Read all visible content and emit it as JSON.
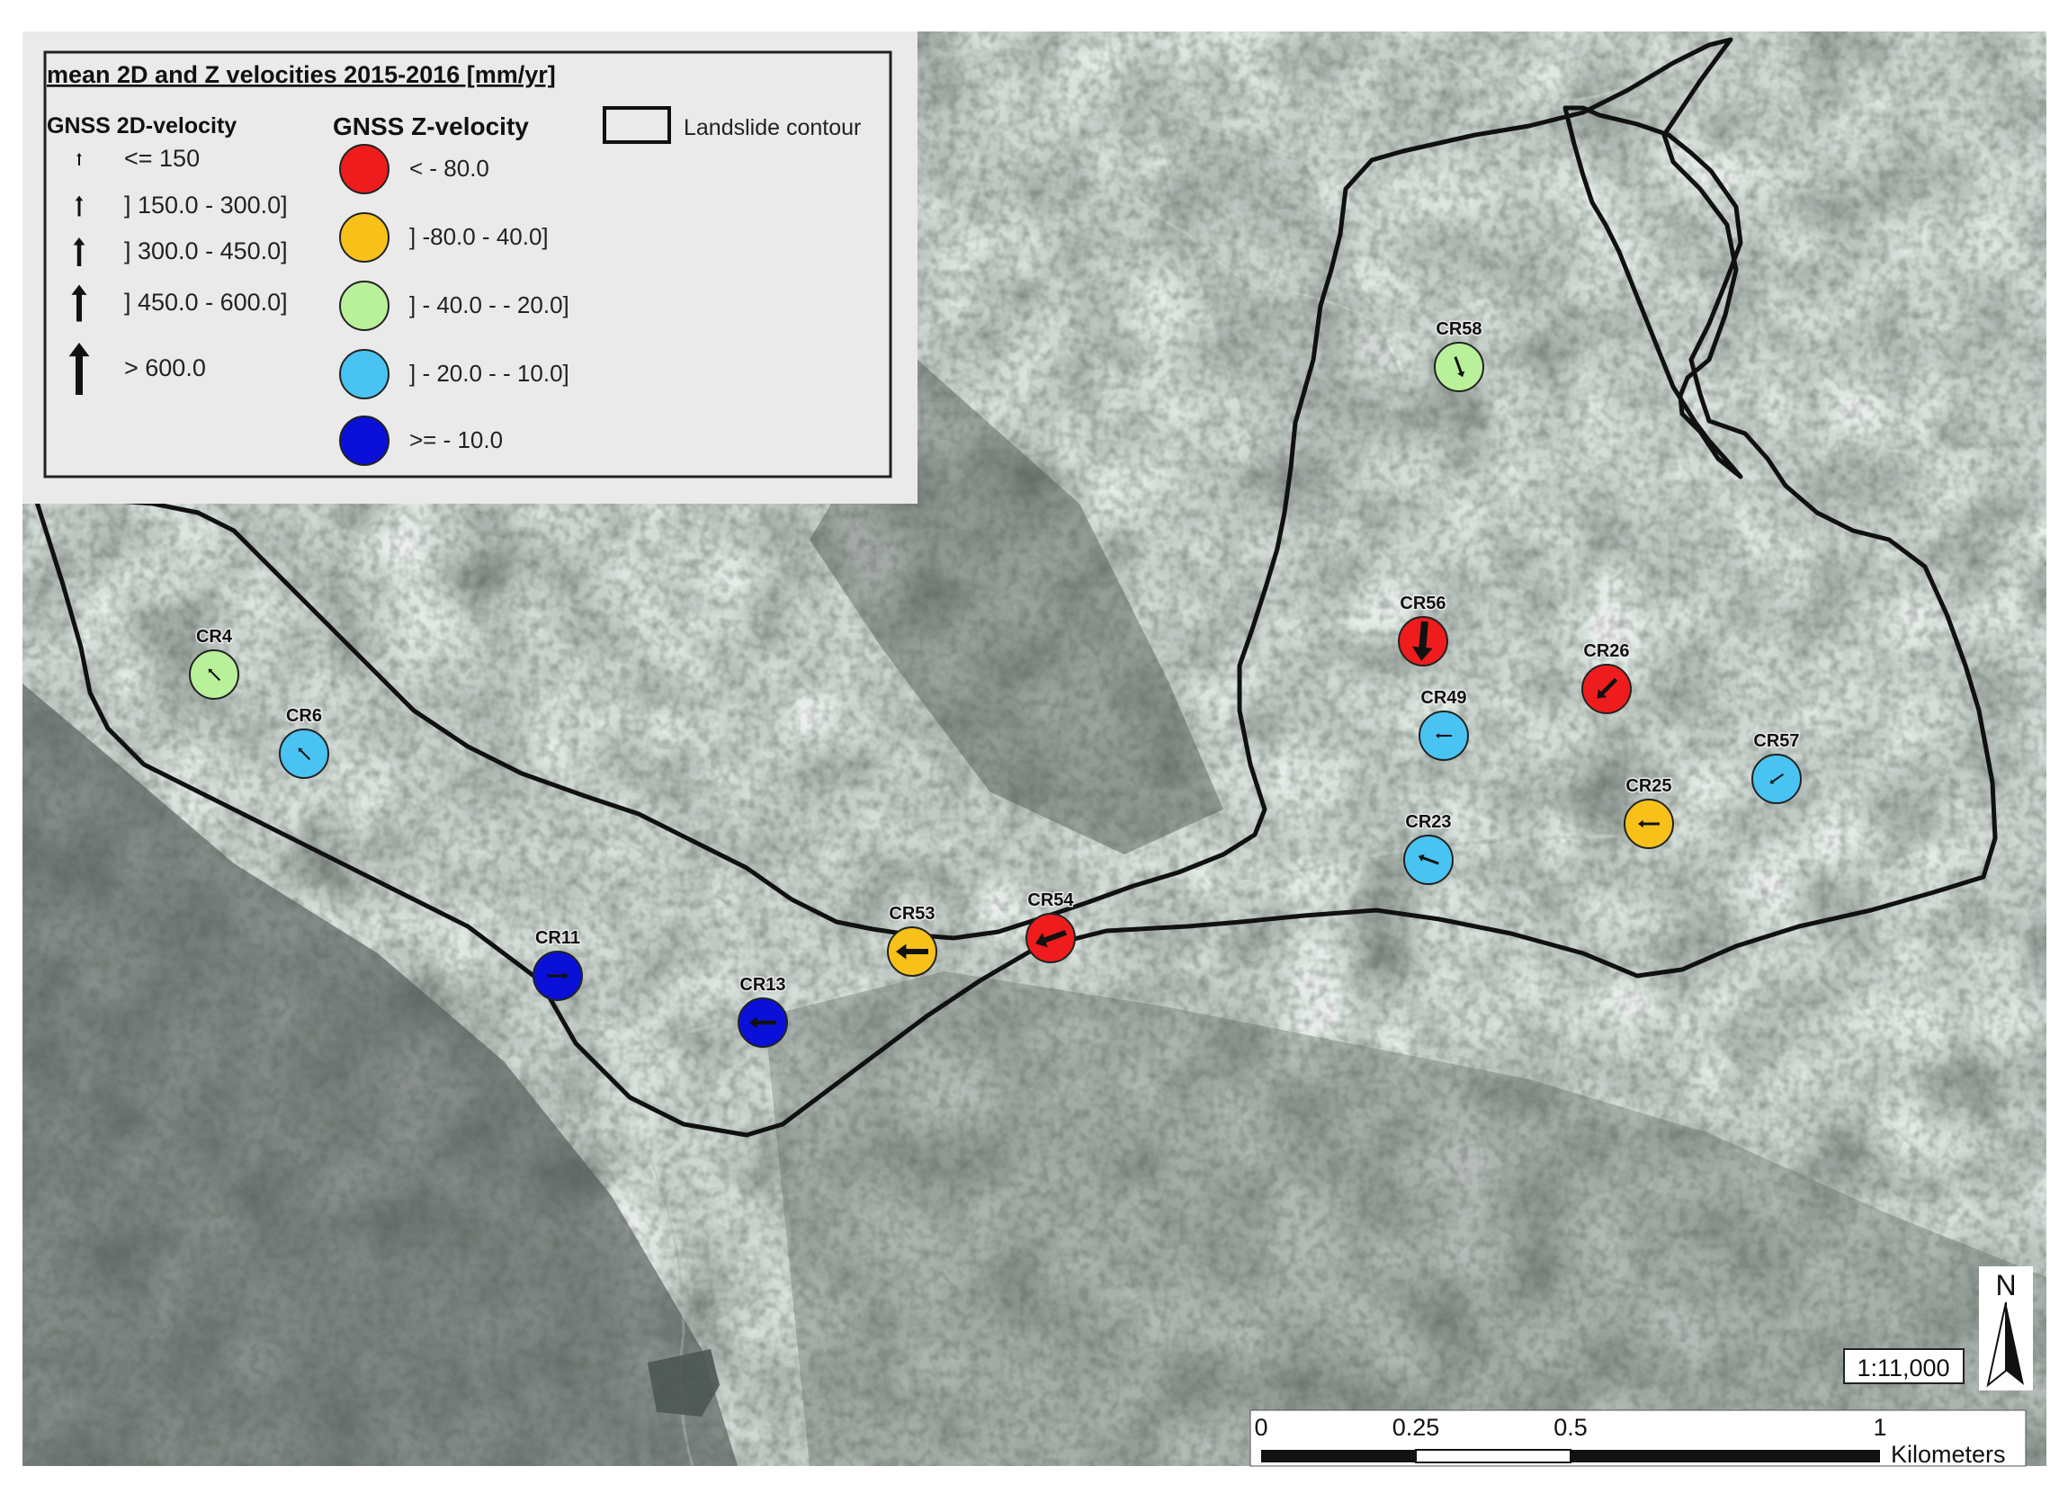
{
  "legend": {
    "title": "mean 2D and Z velocities 2015-2016 [mm/yr]",
    "velocity_2d_title": "GNSS 2D-velocity",
    "velocity_2d_classes": [
      "<= 150",
      "] 150.0 - 300.0]",
      "] 300.0 - 450.0]",
      "] 450.0 - 600.0]",
      "> 600.0"
    ],
    "velocity_z_title": "GNSS Z-velocity",
    "velocity_z_classes": [
      {
        "label": "< - 80.0",
        "color": "#ee1c1c"
      },
      {
        "label": "] -80.0 - 40.0]",
        "color": "#f7c11a"
      },
      {
        "label": "] - 40.0 - - 20.0]",
        "color": "#b8f19a"
      },
      {
        "label": "] - 20.0 - - 10.0]",
        "color": "#49c3f1"
      },
      {
        "label": ">= - 10.0",
        "color": "#0a10d8"
      }
    ],
    "contour_label": "Landslide contour"
  },
  "stations": [
    {
      "name": "CR4",
      "z_class": 2,
      "v_class": 0,
      "dir_deg": 315
    },
    {
      "name": "CR6",
      "z_class": 3,
      "v_class": 0,
      "dir_deg": 315
    },
    {
      "name": "CR11",
      "z_class": 4,
      "v_class": 1,
      "dir_deg": 90
    },
    {
      "name": "CR13",
      "z_class": 4,
      "v_class": 2,
      "dir_deg": 270
    },
    {
      "name": "CR53",
      "z_class": 1,
      "v_class": 3,
      "dir_deg": 270
    },
    {
      "name": "CR54",
      "z_class": 0,
      "v_class": 3,
      "dir_deg": 250
    },
    {
      "name": "CR58",
      "z_class": 2,
      "v_class": 1,
      "dir_deg": 160
    },
    {
      "name": "CR56",
      "z_class": 0,
      "v_class": 4,
      "dir_deg": 185
    },
    {
      "name": "CR26",
      "z_class": 0,
      "v_class": 2,
      "dir_deg": 225
    },
    {
      "name": "CR49",
      "z_class": 3,
      "v_class": 0,
      "dir_deg": 270
    },
    {
      "name": "CR57",
      "z_class": 3,
      "v_class": 0,
      "dir_deg": 235
    },
    {
      "name": "CR25",
      "z_class": 1,
      "v_class": 1,
      "dir_deg": 270
    },
    {
      "name": "CR23",
      "z_class": 3,
      "v_class": 1,
      "dir_deg": 290
    }
  ],
  "scale_text": "1:11,000",
  "north_label": "N",
  "scalebar": {
    "ticks": [
      "0",
      "0.25",
      "0.5",
      "1"
    ],
    "unit": "Kilometers"
  },
  "colors": {
    "contour": "#111111",
    "imagery_base": "#7d8581"
  }
}
